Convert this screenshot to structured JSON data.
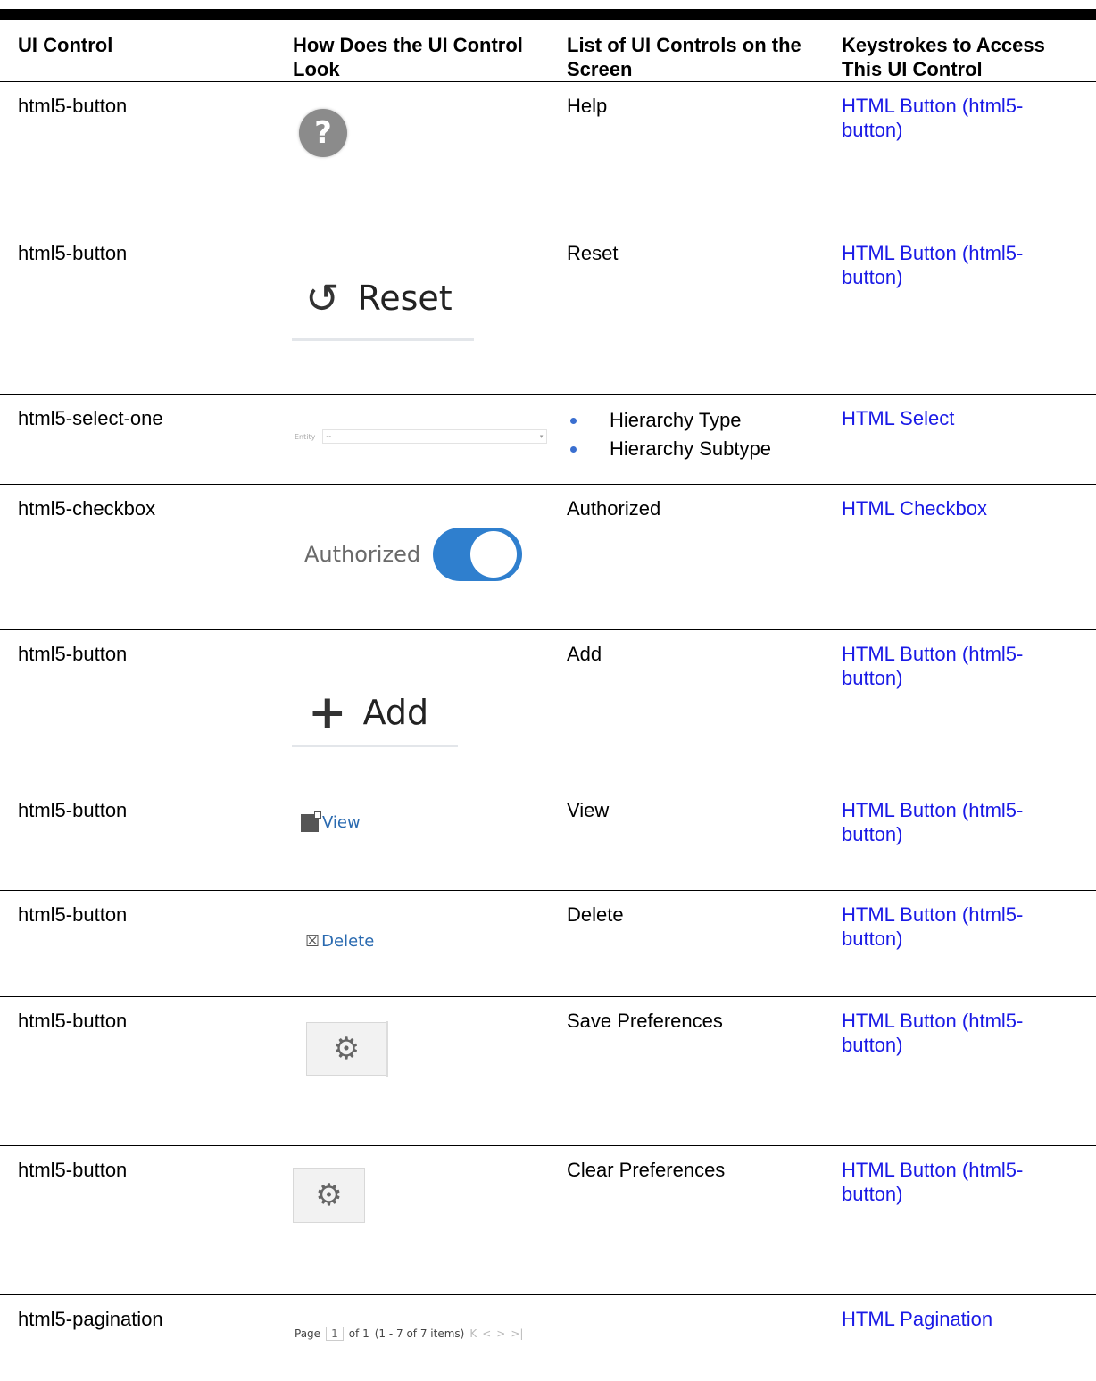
{
  "headers": {
    "col1": "UI Control",
    "col2": "How Does the UI Control Look",
    "col3": "List of UI Controls on the Screen",
    "col4": "Keystrokes to Access This UI Control"
  },
  "rows": [
    {
      "control": "html5-button",
      "look": {
        "kind": "help",
        "glyph": "?"
      },
      "list": [
        "Help"
      ],
      "link": "HTML Button (html5-button)"
    },
    {
      "control": "html5-button",
      "look": {
        "kind": "reset",
        "label": "Reset"
      },
      "list": [
        "Reset"
      ],
      "link": "HTML Button (html5-button)"
    },
    {
      "control": "html5-select-one",
      "look": {
        "kind": "select",
        "label": "Entity",
        "value": "--"
      },
      "list": [
        "Hierarchy Type",
        "Hierarchy Subtype"
      ],
      "link": "HTML Select"
    },
    {
      "control": "html5-checkbox",
      "look": {
        "kind": "toggle",
        "label": "Authorized"
      },
      "list": [
        "Authorized"
      ],
      "link": "HTML Checkbox"
    },
    {
      "control": "html5-button",
      "look": {
        "kind": "add",
        "label": "Add"
      },
      "list": [
        "Add"
      ],
      "link": "HTML Button (html5-button)"
    },
    {
      "control": "html5-button",
      "look": {
        "kind": "view",
        "label": "View"
      },
      "list": [
        "View"
      ],
      "link": "HTML Button (html5-button)"
    },
    {
      "control": "html5-button",
      "look": {
        "kind": "delete",
        "label": "Delete"
      },
      "list": [
        "Delete"
      ],
      "link": "HTML Button (html5-button)"
    },
    {
      "control": "html5-button",
      "look": {
        "kind": "save-prefs"
      },
      "list": [
        "Save Preferences"
      ],
      "link": "HTML Button (html5-button)"
    },
    {
      "control": "html5-button",
      "look": {
        "kind": "clear-prefs"
      },
      "list": [
        "Clear Preferences"
      ],
      "link": "HTML Button (html5-button)"
    },
    {
      "control": "html5-pagination",
      "look": {
        "kind": "pager",
        "page_label": "Page",
        "page": "1",
        "of": "of 1",
        "range": "(1 - 7 of  7  items)"
      },
      "list": [],
      "link": "HTML Pagination"
    }
  ]
}
